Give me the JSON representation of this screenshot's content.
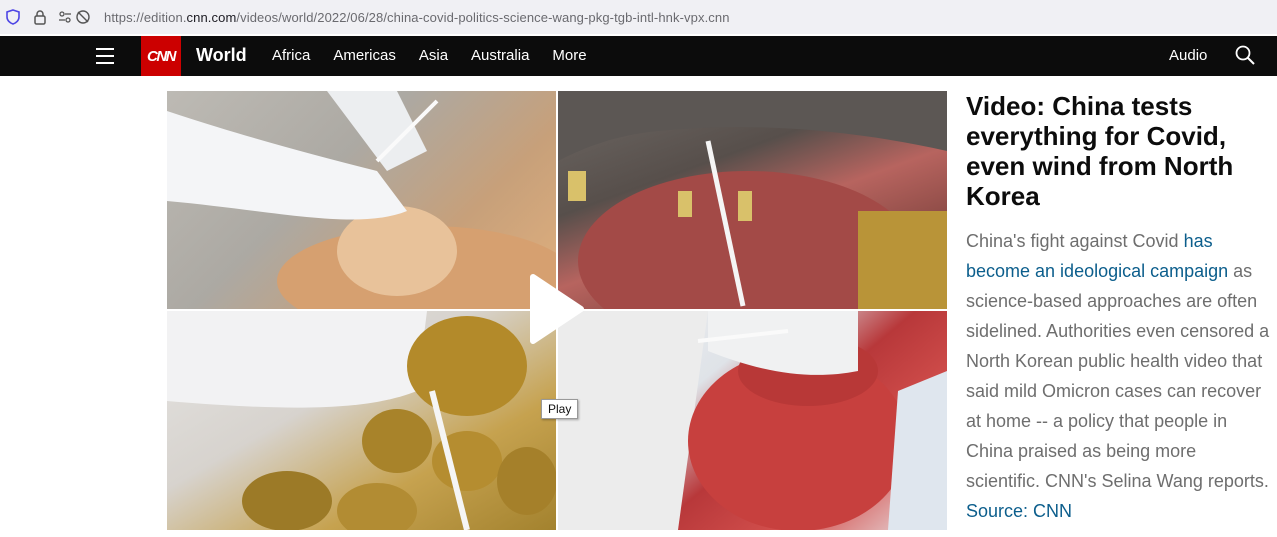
{
  "browser": {
    "url_prefix": "https://edition.",
    "url_host": "cnn.com",
    "url_path": "/videos/world/2022/06/28/china-covid-politics-science-wang-pkg-tgb-intl-hnk-vpx.cnn"
  },
  "nav": {
    "logo": "CNN",
    "section": "World",
    "links": [
      "Africa",
      "Americas",
      "Asia",
      "Australia",
      "More"
    ],
    "audio": "Audio",
    "icons": [
      "hamburger-menu-icon",
      "search-icon"
    ],
    "colors": {
      "bar": "#0c0c0c",
      "logo": "#cc0000"
    }
  },
  "video": {
    "tooltip": "Play",
    "icon": "play-icon"
  },
  "article": {
    "headline": "Video: China tests everything for Covid, even wind from North Korea",
    "desc_before": "China's fight against Covid ",
    "desc_link": "has become an ideological campaign",
    "desc_after": " as science-based approaches are often sidelined. Authorities even censored a North Korean public health video that said mild Omicron cases can recover at home -- a policy that people in China praised as being more scientific. CNN's Selina Wang reports. ",
    "source": "Source: CNN",
    "link_color": "#0c5e8c"
  }
}
